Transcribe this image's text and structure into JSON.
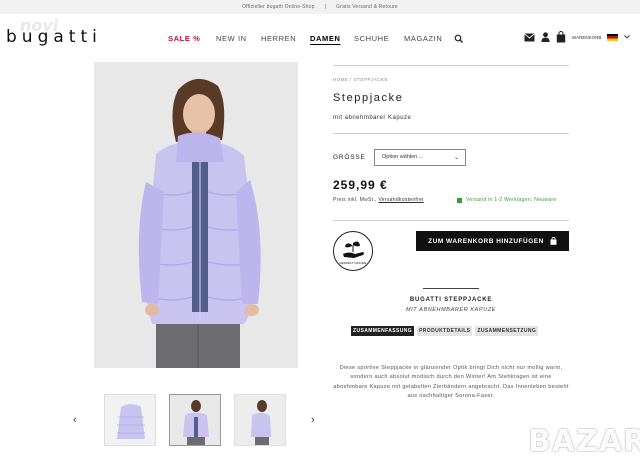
{
  "topbar": {
    "official": "Offizieller bugatti Online-Shop",
    "sep": "|",
    "shipping": "Gratis Versand & Retoure"
  },
  "header": {
    "logo": "bugatti",
    "nav": [
      "SALE %",
      "NEW IN",
      "HERREN",
      "DAMEN",
      "SCHUHE",
      "MAGAZIN"
    ],
    "cart_label": "WARENKORB"
  },
  "product": {
    "breadcrumb": "HOME /   STEPPJACKE",
    "title": "Steppjacke",
    "subtitle": "mit abnehmbarer Kapuze",
    "size_label": "GRÖSSE",
    "size_placeholder": "Option wählen ...",
    "price": "259,99 €",
    "price_note": "Preis inkl. MwSt.,",
    "price_link": "Versandkostenfrei",
    "shipping_info": "Versand in 1-2 Werktagen, Neuware",
    "badge_text": "RESPECT NATURE",
    "cart_button": "ZUM WARENKORB HINZUFÜGEN",
    "desc_heading": "BUGATTI STEPPJACKE",
    "desc_subheading": "MIT ABNEHMBARER KAPUZE",
    "tabs": [
      "ZUSAMMENFASSUNG",
      "PRODUKTDETAILS",
      "ZUSAMMENSETZUNG"
    ],
    "description": "Diese sportive Steppjacke in glänzender Optik bringt Dich nicht nur mollig warm, sondern auch absolut modisch durch den Winter! Am Stehkragen ist eine abnehmbare Kapuze mit gelabelten Zierbändern angebracht. Das Innenleben besteht aus nachhaltiger Sorona-Faser."
  },
  "watermark": {
    "top_left": "novi",
    "bottom_right": "BAZAR"
  },
  "colors": {
    "sale": "#c8102e",
    "jacket": "#c9c3f0",
    "button": "#111111",
    "shipping": "#3a9a3a"
  }
}
